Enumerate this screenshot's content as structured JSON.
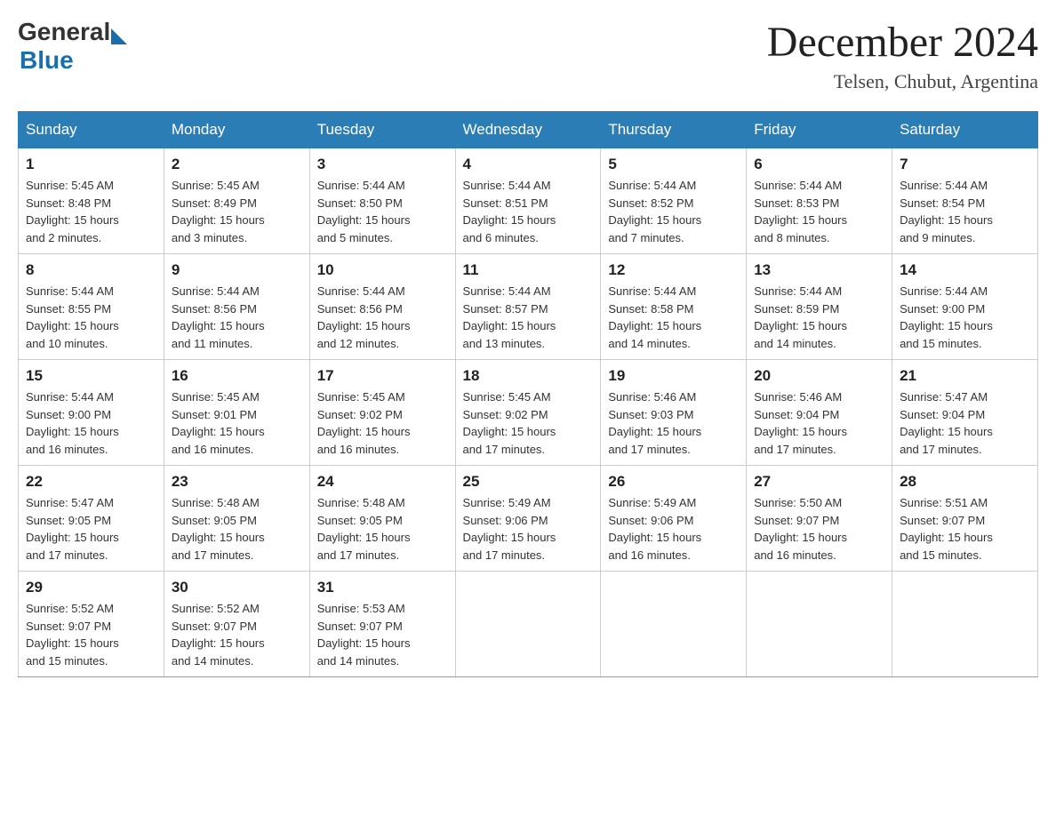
{
  "header": {
    "month_title": "December 2024",
    "location": "Telsen, Chubut, Argentina",
    "logo_general": "General",
    "logo_blue": "Blue"
  },
  "days_of_week": [
    "Sunday",
    "Monday",
    "Tuesday",
    "Wednesday",
    "Thursday",
    "Friday",
    "Saturday"
  ],
  "weeks": [
    [
      {
        "day": "1",
        "sunrise": "5:45 AM",
        "sunset": "8:48 PM",
        "daylight": "15 hours and 2 minutes."
      },
      {
        "day": "2",
        "sunrise": "5:45 AM",
        "sunset": "8:49 PM",
        "daylight": "15 hours and 3 minutes."
      },
      {
        "day": "3",
        "sunrise": "5:44 AM",
        "sunset": "8:50 PM",
        "daylight": "15 hours and 5 minutes."
      },
      {
        "day": "4",
        "sunrise": "5:44 AM",
        "sunset": "8:51 PM",
        "daylight": "15 hours and 6 minutes."
      },
      {
        "day": "5",
        "sunrise": "5:44 AM",
        "sunset": "8:52 PM",
        "daylight": "15 hours and 7 minutes."
      },
      {
        "day": "6",
        "sunrise": "5:44 AM",
        "sunset": "8:53 PM",
        "daylight": "15 hours and 8 minutes."
      },
      {
        "day": "7",
        "sunrise": "5:44 AM",
        "sunset": "8:54 PM",
        "daylight": "15 hours and 9 minutes."
      }
    ],
    [
      {
        "day": "8",
        "sunrise": "5:44 AM",
        "sunset": "8:55 PM",
        "daylight": "15 hours and 10 minutes."
      },
      {
        "day": "9",
        "sunrise": "5:44 AM",
        "sunset": "8:56 PM",
        "daylight": "15 hours and 11 minutes."
      },
      {
        "day": "10",
        "sunrise": "5:44 AM",
        "sunset": "8:56 PM",
        "daylight": "15 hours and 12 minutes."
      },
      {
        "day": "11",
        "sunrise": "5:44 AM",
        "sunset": "8:57 PM",
        "daylight": "15 hours and 13 minutes."
      },
      {
        "day": "12",
        "sunrise": "5:44 AM",
        "sunset": "8:58 PM",
        "daylight": "15 hours and 14 minutes."
      },
      {
        "day": "13",
        "sunrise": "5:44 AM",
        "sunset": "8:59 PM",
        "daylight": "15 hours and 14 minutes."
      },
      {
        "day": "14",
        "sunrise": "5:44 AM",
        "sunset": "9:00 PM",
        "daylight": "15 hours and 15 minutes."
      }
    ],
    [
      {
        "day": "15",
        "sunrise": "5:44 AM",
        "sunset": "9:00 PM",
        "daylight": "15 hours and 16 minutes."
      },
      {
        "day": "16",
        "sunrise": "5:45 AM",
        "sunset": "9:01 PM",
        "daylight": "15 hours and 16 minutes."
      },
      {
        "day": "17",
        "sunrise": "5:45 AM",
        "sunset": "9:02 PM",
        "daylight": "15 hours and 16 minutes."
      },
      {
        "day": "18",
        "sunrise": "5:45 AM",
        "sunset": "9:02 PM",
        "daylight": "15 hours and 17 minutes."
      },
      {
        "day": "19",
        "sunrise": "5:46 AM",
        "sunset": "9:03 PM",
        "daylight": "15 hours and 17 minutes."
      },
      {
        "day": "20",
        "sunrise": "5:46 AM",
        "sunset": "9:04 PM",
        "daylight": "15 hours and 17 minutes."
      },
      {
        "day": "21",
        "sunrise": "5:47 AM",
        "sunset": "9:04 PM",
        "daylight": "15 hours and 17 minutes."
      }
    ],
    [
      {
        "day": "22",
        "sunrise": "5:47 AM",
        "sunset": "9:05 PM",
        "daylight": "15 hours and 17 minutes."
      },
      {
        "day": "23",
        "sunrise": "5:48 AM",
        "sunset": "9:05 PM",
        "daylight": "15 hours and 17 minutes."
      },
      {
        "day": "24",
        "sunrise": "5:48 AM",
        "sunset": "9:05 PM",
        "daylight": "15 hours and 17 minutes."
      },
      {
        "day": "25",
        "sunrise": "5:49 AM",
        "sunset": "9:06 PM",
        "daylight": "15 hours and 17 minutes."
      },
      {
        "day": "26",
        "sunrise": "5:49 AM",
        "sunset": "9:06 PM",
        "daylight": "15 hours and 16 minutes."
      },
      {
        "day": "27",
        "sunrise": "5:50 AM",
        "sunset": "9:07 PM",
        "daylight": "15 hours and 16 minutes."
      },
      {
        "day": "28",
        "sunrise": "5:51 AM",
        "sunset": "9:07 PM",
        "daylight": "15 hours and 15 minutes."
      }
    ],
    [
      {
        "day": "29",
        "sunrise": "5:52 AM",
        "sunset": "9:07 PM",
        "daylight": "15 hours and 15 minutes."
      },
      {
        "day": "30",
        "sunrise": "5:52 AM",
        "sunset": "9:07 PM",
        "daylight": "15 hours and 14 minutes."
      },
      {
        "day": "31",
        "sunrise": "5:53 AM",
        "sunset": "9:07 PM",
        "daylight": "15 hours and 14 minutes."
      },
      null,
      null,
      null,
      null
    ]
  ],
  "labels": {
    "sunrise": "Sunrise:",
    "sunset": "Sunset:",
    "daylight": "Daylight:"
  }
}
